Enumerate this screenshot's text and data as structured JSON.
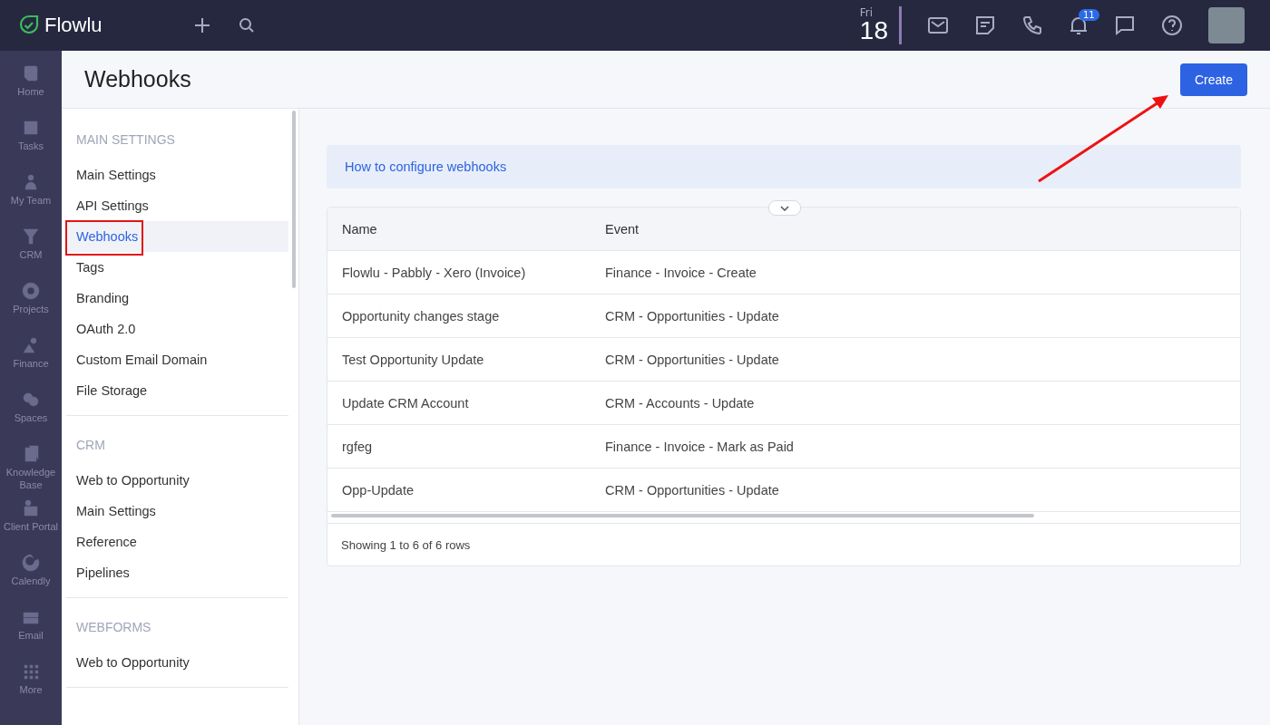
{
  "topbar": {
    "logo": "Flowlu",
    "date": {
      "weekday": "Fri",
      "day": "18"
    },
    "notification_count": "11"
  },
  "rail": [
    {
      "kind": "home",
      "label": "Home"
    },
    {
      "kind": "tasks",
      "label": "Tasks"
    },
    {
      "kind": "team",
      "label": "My Team"
    },
    {
      "kind": "crm",
      "label": "CRM"
    },
    {
      "kind": "projects",
      "label": "Projects"
    },
    {
      "kind": "finance",
      "label": "Finance"
    },
    {
      "kind": "spaces",
      "label": "Spaces"
    },
    {
      "kind": "kb",
      "label": "Knowledge Base"
    },
    {
      "kind": "portal",
      "label": "Client Portal"
    },
    {
      "kind": "calendly",
      "label": "Calendly"
    },
    {
      "kind": "email",
      "label": "Email"
    },
    {
      "kind": "more",
      "label": "More"
    }
  ],
  "page": {
    "title": "Webhooks",
    "create_button": "Create"
  },
  "sidebar": [
    {
      "heading": "MAIN SETTINGS",
      "items": [
        {
          "label": "Main Settings",
          "selected": false
        },
        {
          "label": "API Settings",
          "selected": false
        },
        {
          "label": "Webhooks",
          "selected": true
        },
        {
          "label": "Tags",
          "selected": false
        },
        {
          "label": "Branding",
          "selected": false
        },
        {
          "label": "OAuth 2.0",
          "selected": false
        },
        {
          "label": "Custom Email Domain",
          "selected": false
        },
        {
          "label": "File Storage",
          "selected": false
        }
      ]
    },
    {
      "heading": "CRM",
      "items": [
        {
          "label": "Web to Opportunity",
          "selected": false
        },
        {
          "label": "Main Settings",
          "selected": false
        },
        {
          "label": "Reference",
          "selected": false
        },
        {
          "label": "Pipelines",
          "selected": false
        }
      ]
    },
    {
      "heading": "WEBFORMS",
      "items": [
        {
          "label": "Web to Opportunity",
          "selected": false
        }
      ]
    }
  ],
  "help_link": "How to configure webhooks",
  "table": {
    "expanded": false,
    "columns": [
      "Name",
      "Event"
    ],
    "rows": [
      [
        "Flowlu - Pabbly - Xero (Invoice)",
        "Finance - Invoice - Create"
      ],
      [
        "Opportunity changes stage",
        "CRM - Opportunities - Update"
      ],
      [
        "Test Opportunity Update",
        "CRM - Opportunities - Update"
      ],
      [
        "Update CRM Account",
        "CRM - Accounts - Update"
      ],
      [
        "rgfeg",
        "Finance - Invoice - Mark as Paid"
      ],
      [
        "Opp-Update",
        "CRM - Opportunities - Update"
      ]
    ],
    "footer": "Showing 1 to 6 of 6 rows"
  }
}
